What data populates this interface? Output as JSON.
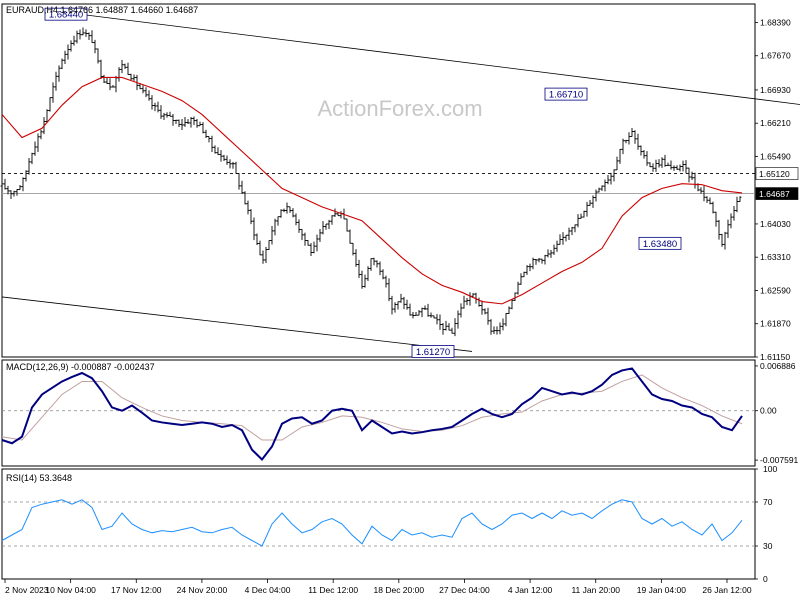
{
  "colors": {
    "price": "#000000",
    "ma": "#cc0000",
    "macd": "#000080",
    "signal": "#c0a0a0",
    "rsi": "#1e90ff",
    "channel": "#000000",
    "level": "#000000",
    "watermark": "#c8c8c8",
    "panel_border": "#000000"
  },
  "chart_data": [
    {
      "panel": "price",
      "type": "candlestick",
      "title": "EURAUD,H4  1.64766 1.64887 1.64660 1.64687",
      "watermark": "ActionForex.com",
      "ylim": [
        1.6115,
        1.6879
      ],
      "y_ticks": [
        "1.68390",
        "1.67670",
        "1.66930",
        "1.66210",
        "1.65490",
        "1.64030",
        "1.63310",
        "1.62590",
        "1.61870",
        "1.61150"
      ],
      "level_label": "1.65120",
      "level_value": 1.6512,
      "current_label": "1.64687",
      "current_value": 1.64687,
      "annotations": [
        {
          "text": "1.68440",
          "x": 80,
          "y": 1.6844
        },
        {
          "text": "1.66710",
          "x": 580,
          "y": 1.6671
        },
        {
          "text": "1.63480",
          "x": 674,
          "y": 1.6348
        },
        {
          "text": "1.61270",
          "x": 447,
          "y": 1.6127
        }
      ],
      "channel_upper": [
        [
          85,
          1.6855
        ],
        [
          800,
          1.6661
        ]
      ],
      "channel_lower": [
        [
          0,
          1.6245
        ],
        [
          470,
          1.6127
        ]
      ],
      "close_series": [
        [
          0,
          1.6485
        ],
        [
          10,
          1.647
        ],
        [
          20,
          1.649
        ],
        [
          30,
          1.656
        ],
        [
          40,
          1.661
        ],
        [
          50,
          1.669
        ],
        [
          60,
          1.676
        ],
        [
          70,
          1.68
        ],
        [
          80,
          1.6822
        ],
        [
          90,
          1.68
        ],
        [
          100,
          1.672
        ],
        [
          110,
          1.67
        ],
        [
          120,
          1.675
        ],
        [
          130,
          1.672
        ],
        [
          140,
          1.669
        ],
        [
          150,
          1.666
        ],
        [
          160,
          1.664
        ],
        [
          170,
          1.663
        ],
        [
          180,
          1.662
        ],
        [
          190,
          1.663
        ],
        [
          200,
          1.661
        ],
        [
          210,
          1.657
        ],
        [
          220,
          1.6545
        ],
        [
          230,
          1.6535
        ],
        [
          240,
          1.647
        ],
        [
          250,
          1.64
        ],
        [
          260,
          1.632
        ],
        [
          270,
          1.639
        ],
        [
          280,
          1.644
        ],
        [
          290,
          1.643
        ],
        [
          300,
          1.638
        ],
        [
          310,
          1.634
        ],
        [
          320,
          1.639
        ],
        [
          330,
          1.642
        ],
        [
          340,
          1.643
        ],
        [
          350,
          1.635
        ],
        [
          360,
          1.627
        ],
        [
          370,
          1.633
        ],
        [
          380,
          1.63
        ],
        [
          390,
          1.622
        ],
        [
          400,
          1.624
        ],
        [
          410,
          1.62
        ],
        [
          420,
          1.622
        ],
        [
          430,
          1.62
        ],
        [
          440,
          1.618
        ],
        [
          450,
          1.617
        ],
        [
          460,
          1.623
        ],
        [
          470,
          1.625
        ],
        [
          480,
          1.622
        ],
        [
          490,
          1.617
        ],
        [
          500,
          1.618
        ],
        [
          510,
          1.624
        ],
        [
          520,
          1.63
        ],
        [
          530,
          1.632
        ],
        [
          540,
          1.633
        ],
        [
          550,
          1.634
        ],
        [
          560,
          1.637
        ],
        [
          570,
          1.64
        ],
        [
          580,
          1.642
        ],
        [
          590,
          1.646
        ],
        [
          600,
          1.649
        ],
        [
          610,
          1.651
        ],
        [
          620,
          1.658
        ],
        [
          630,
          1.66
        ],
        [
          640,
          1.655
        ],
        [
          650,
          1.6525
        ],
        [
          660,
          1.654
        ],
        [
          670,
          1.652
        ],
        [
          680,
          1.653
        ],
        [
          690,
          1.65
        ],
        [
          700,
          1.647
        ],
        [
          710,
          1.644
        ],
        [
          720,
          1.636
        ],
        [
          730,
          1.643
        ],
        [
          740,
          1.6469
        ]
      ],
      "ma_series": [
        [
          0,
          1.664
        ],
        [
          20,
          1.659
        ],
        [
          40,
          1.661
        ],
        [
          60,
          1.666
        ],
        [
          80,
          1.67
        ],
        [
          100,
          1.672
        ],
        [
          120,
          1.672
        ],
        [
          140,
          1.6705
        ],
        [
          160,
          1.669
        ],
        [
          180,
          1.667
        ],
        [
          200,
          1.664
        ],
        [
          220,
          1.66
        ],
        [
          240,
          1.656
        ],
        [
          260,
          1.652
        ],
        [
          280,
          1.648
        ],
        [
          300,
          1.646
        ],
        [
          320,
          1.644
        ],
        [
          340,
          1.6425
        ],
        [
          360,
          1.641
        ],
        [
          380,
          1.637
        ],
        [
          400,
          1.633
        ],
        [
          420,
          1.6295
        ],
        [
          440,
          1.627
        ],
        [
          460,
          1.6255
        ],
        [
          480,
          1.6235
        ],
        [
          500,
          1.623
        ],
        [
          520,
          1.625
        ],
        [
          540,
          1.6275
        ],
        [
          560,
          1.63
        ],
        [
          580,
          1.632
        ],
        [
          600,
          1.635
        ],
        [
          620,
          1.642
        ],
        [
          640,
          1.646
        ],
        [
          660,
          1.648
        ],
        [
          680,
          1.649
        ],
        [
          700,
          1.6488
        ],
        [
          720,
          1.6475
        ],
        [
          740,
          1.647
        ]
      ]
    },
    {
      "panel": "macd",
      "type": "line",
      "title": "MACD(12,26,9) -0.000887 -0.002437",
      "ylim": [
        -0.0085,
        0.0078
      ],
      "y_ticks": [
        "0.006886",
        "0.00",
        "-0.007591"
      ],
      "macd_series": [
        [
          0,
          -0.0045
        ],
        [
          10,
          -0.005
        ],
        [
          20,
          -0.004
        ],
        [
          30,
          0.0005
        ],
        [
          40,
          0.0025
        ],
        [
          50,
          0.0035
        ],
        [
          60,
          0.0045
        ],
        [
          70,
          0.0052
        ],
        [
          80,
          0.0058
        ],
        [
          90,
          0.005
        ],
        [
          100,
          0.003
        ],
        [
          110,
          0.0005
        ],
        [
          120,
          0.0
        ],
        [
          130,
          0.0008
        ],
        [
          140,
          -0.0003
        ],
        [
          150,
          -0.0015
        ],
        [
          160,
          -0.0018
        ],
        [
          170,
          -0.002
        ],
        [
          180,
          -0.0022
        ],
        [
          190,
          -0.002
        ],
        [
          200,
          -0.0018
        ],
        [
          210,
          -0.002
        ],
        [
          220,
          -0.0025
        ],
        [
          230,
          -0.0022
        ],
        [
          240,
          -0.003
        ],
        [
          250,
          -0.006
        ],
        [
          260,
          -0.0075
        ],
        [
          270,
          -0.0055
        ],
        [
          280,
          -0.002
        ],
        [
          290,
          -0.0012
        ],
        [
          300,
          -0.001
        ],
        [
          310,
          -0.002
        ],
        [
          320,
          -0.0015
        ],
        [
          330,
          0.0
        ],
        [
          340,
          0.0003
        ],
        [
          350,
          0.0
        ],
        [
          360,
          -0.003
        ],
        [
          370,
          -0.0015
        ],
        [
          380,
          -0.0025
        ],
        [
          390,
          -0.0035
        ],
        [
          400,
          -0.0032
        ],
        [
          410,
          -0.0035
        ],
        [
          420,
          -0.0033
        ],
        [
          430,
          -0.003
        ],
        [
          440,
          -0.0028
        ],
        [
          450,
          -0.0025
        ],
        [
          460,
          -0.0015
        ],
        [
          470,
          -0.0005
        ],
        [
          480,
          0.0003
        ],
        [
          490,
          -0.0005
        ],
        [
          500,
          -0.001
        ],
        [
          510,
          -0.0005
        ],
        [
          520,
          0.001
        ],
        [
          530,
          0.002
        ],
        [
          540,
          0.0035
        ],
        [
          550,
          0.003
        ],
        [
          560,
          0.0025
        ],
        [
          570,
          0.0028
        ],
        [
          580,
          0.0025
        ],
        [
          590,
          0.003
        ],
        [
          600,
          0.004
        ],
        [
          610,
          0.0055
        ],
        [
          620,
          0.0062
        ],
        [
          630,
          0.0065
        ],
        [
          640,
          0.0045
        ],
        [
          650,
          0.0025
        ],
        [
          660,
          0.0018
        ],
        [
          670,
          0.0015
        ],
        [
          680,
          0.0008
        ],
        [
          690,
          0.0005
        ],
        [
          700,
          -0.0005
        ],
        [
          710,
          -0.001
        ],
        [
          720,
          -0.0025
        ],
        [
          730,
          -0.003
        ],
        [
          740,
          -0.0008
        ]
      ],
      "signal_series": [
        [
          0,
          -0.004
        ],
        [
          20,
          -0.0045
        ],
        [
          40,
          -0.001
        ],
        [
          60,
          0.0025
        ],
        [
          80,
          0.0045
        ],
        [
          100,
          0.0045
        ],
        [
          120,
          0.002
        ],
        [
          140,
          0.0005
        ],
        [
          160,
          -0.0008
        ],
        [
          180,
          -0.0015
        ],
        [
          200,
          -0.0018
        ],
        [
          220,
          -0.002
        ],
        [
          240,
          -0.0023
        ],
        [
          260,
          -0.0045
        ],
        [
          280,
          -0.0045
        ],
        [
          300,
          -0.0025
        ],
        [
          320,
          -0.0018
        ],
        [
          340,
          -0.0008
        ],
        [
          360,
          -0.001
        ],
        [
          380,
          -0.0018
        ],
        [
          400,
          -0.0028
        ],
        [
          420,
          -0.0032
        ],
        [
          440,
          -0.003
        ],
        [
          460,
          -0.0023
        ],
        [
          480,
          -0.001
        ],
        [
          500,
          -0.0005
        ],
        [
          520,
          -0.0002
        ],
        [
          540,
          0.0015
        ],
        [
          560,
          0.0025
        ],
        [
          580,
          0.0027
        ],
        [
          600,
          0.003
        ],
        [
          620,
          0.0045
        ],
        [
          640,
          0.0055
        ],
        [
          660,
          0.0035
        ],
        [
          680,
          0.002
        ],
        [
          700,
          0.0008
        ],
        [
          720,
          -0.0008
        ],
        [
          740,
          -0.002
        ]
      ]
    },
    {
      "panel": "rsi",
      "type": "line",
      "title": "RSI(14) 53.3648",
      "ylim": [
        0,
        100
      ],
      "y_ticks": [
        "100",
        "70",
        "30",
        "0"
      ],
      "levels": [
        70,
        30
      ],
      "rsi_series": [
        [
          0,
          35
        ],
        [
          10,
          40
        ],
        [
          20,
          45
        ],
        [
          30,
          65
        ],
        [
          40,
          68
        ],
        [
          50,
          70
        ],
        [
          60,
          72
        ],
        [
          70,
          68
        ],
        [
          80,
          72
        ],
        [
          90,
          65
        ],
        [
          100,
          45
        ],
        [
          110,
          48
        ],
        [
          120,
          60
        ],
        [
          130,
          50
        ],
        [
          140,
          45
        ],
        [
          150,
          42
        ],
        [
          160,
          44
        ],
        [
          170,
          43
        ],
        [
          180,
          45
        ],
        [
          190,
          47
        ],
        [
          200,
          43
        ],
        [
          210,
          42
        ],
        [
          220,
          45
        ],
        [
          230,
          47
        ],
        [
          240,
          40
        ],
        [
          250,
          35
        ],
        [
          260,
          30
        ],
        [
          270,
          50
        ],
        [
          280,
          60
        ],
        [
          290,
          50
        ],
        [
          300,
          42
        ],
        [
          310,
          45
        ],
        [
          320,
          52
        ],
        [
          330,
          55
        ],
        [
          340,
          50
        ],
        [
          350,
          40
        ],
        [
          360,
          32
        ],
        [
          370,
          48
        ],
        [
          380,
          40
        ],
        [
          390,
          35
        ],
        [
          400,
          45
        ],
        [
          410,
          40
        ],
        [
          420,
          42
        ],
        [
          430,
          38
        ],
        [
          440,
          40
        ],
        [
          450,
          38
        ],
        [
          460,
          55
        ],
        [
          470,
          60
        ],
        [
          480,
          50
        ],
        [
          490,
          45
        ],
        [
          500,
          50
        ],
        [
          510,
          58
        ],
        [
          520,
          60
        ],
        [
          530,
          55
        ],
        [
          540,
          60
        ],
        [
          550,
          55
        ],
        [
          560,
          62
        ],
        [
          570,
          58
        ],
        [
          580,
          60
        ],
        [
          590,
          55
        ],
        [
          600,
          62
        ],
        [
          610,
          68
        ],
        [
          620,
          72
        ],
        [
          630,
          70
        ],
        [
          640,
          55
        ],
        [
          650,
          50
        ],
        [
          660,
          55
        ],
        [
          670,
          48
        ],
        [
          680,
          52
        ],
        [
          690,
          45
        ],
        [
          700,
          40
        ],
        [
          710,
          50
        ],
        [
          720,
          35
        ],
        [
          730,
          42
        ],
        [
          740,
          53.4
        ]
      ]
    }
  ],
  "x_axis": {
    "labels": [
      "2 Nov 2023",
      "10 Nov 04:00",
      "17 Nov 12:00",
      "24 Nov 20:00",
      "4 Dec 04:00",
      "11 Dec 12:00",
      "18 Dec 20:00",
      "27 Dec 04:00",
      "4 Jan 12:00",
      "11 Jan 20:00",
      "19 Jan 04:00",
      "26 Jan 12:00"
    ]
  }
}
